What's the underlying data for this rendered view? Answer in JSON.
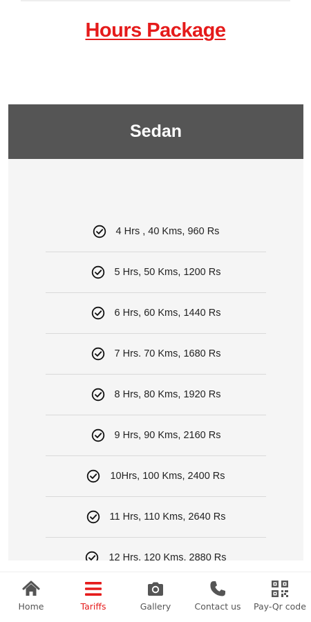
{
  "page": {
    "title": "Hours Package"
  },
  "card": {
    "title": "Sedan",
    "packages": [
      "4 Hrs , 40 Kms, 960 Rs",
      "5 Hrs, 50 Kms, 1200 Rs",
      "6 Hrs, 60 Kms, 1440 Rs",
      "7 Hrs. 70 Kms, 1680 Rs",
      "8 Hrs, 80 Kms, 1920 Rs",
      "9 Hrs, 90 Kms, 2160 Rs",
      "10Hrs, 100 Kms, 2400 Rs",
      "11 Hrs, 110 Kms, 2640 Rs",
      "12 Hrs, 120 Kms, 2880 Rs"
    ]
  },
  "bottom_nav": {
    "items": [
      {
        "label": "Home",
        "icon": "home-icon"
      },
      {
        "label": "Tariffs",
        "icon": "menu-icon",
        "active": true
      },
      {
        "label": "Gallery",
        "icon": "camera-icon"
      },
      {
        "label": "Contact us",
        "icon": "phone-icon"
      },
      {
        "label": "Pay-Qr code",
        "icon": "qr-code-icon"
      }
    ]
  },
  "colors": {
    "accent": "#e51b1b",
    "header_bg": "#555555",
    "card_bg": "#f5f5f5",
    "nav_icon": "#555555"
  }
}
